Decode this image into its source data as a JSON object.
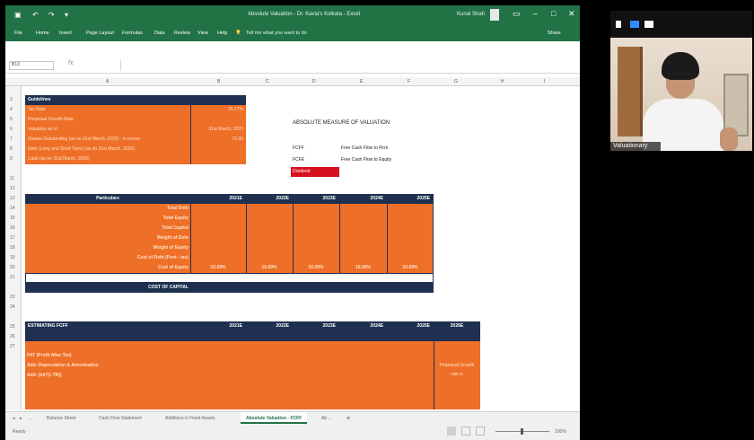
{
  "window": {
    "title": "Absolute Valuation - Dr. Kavia's Kolkata - Excel",
    "user": "Kunal Shah",
    "min_glyph": "–",
    "max_glyph": "□",
    "close_glyph": "✕"
  },
  "ribbon": {
    "tabs": [
      "File",
      "Home",
      "Insert",
      "Page Layout",
      "Formulas",
      "Data",
      "Review",
      "View",
      "Help"
    ],
    "tell_me": "Tell me what you want to do",
    "share": "Share"
  },
  "formula_bar": {
    "name_box": "B13",
    "fx": "fx"
  },
  "columns": [
    "A",
    "B",
    "C",
    "D",
    "E",
    "F",
    "G",
    "H",
    "I"
  ],
  "guidelines": {
    "header": "Guidelines",
    "rows": [
      {
        "label": "Tax Rate",
        "value": "25.17%"
      },
      {
        "label": "Perpetual Growth Rate",
        "value": ""
      },
      {
        "label": "Valuation as of",
        "value": "31st March, 2020"
      },
      {
        "label": "Shares Outstanding (as on 31st March, 2020) - in crores",
        "value": "72.00"
      },
      {
        "label": "Debt (Long and Short Term) (as on 31st March, 2020)",
        "value": ""
      },
      {
        "label": "Cash (as on 31st March, 2020)",
        "value": ""
      }
    ]
  },
  "absolute": {
    "title": "ABSOLUTE MEASURE OF VALUATION",
    "items": [
      {
        "abbr": "FCFF",
        "desc": "Free Cash Flow to Firm"
      },
      {
        "abbr": "FCFE",
        "desc": "Free Cash Flow to Equity"
      },
      {
        "abbr": "Dividend",
        "desc": ""
      }
    ]
  },
  "particulars": {
    "header": "Particulars",
    "years": [
      "2021E",
      "2022E",
      "2023E",
      "2024E",
      "2025E"
    ],
    "rows": [
      "Total Debt",
      "Total Equity",
      "Total Capital",
      "Weight of Debt",
      "Weight of Equity",
      "Cost of Debt (Post - tax)",
      "Cost of Equity"
    ],
    "cost_of_equity": [
      "10.09%",
      "10.09%",
      "10.09%",
      "10.09%",
      "10.09%"
    ],
    "cost_of_capital": "COST OF CAPITAL"
  },
  "fcff": {
    "header": "ESTIMATING FCFF",
    "years": [
      "2021E",
      "2022E",
      "2023E",
      "2024E",
      "2025E",
      "2026E"
    ],
    "rows": [
      "PAT (Profit After Tax)",
      "Add: Depreciation & Amortization",
      "Add: (Int*(1-TR))"
    ],
    "perpetual_note": "Perpetual Growth rate is"
  },
  "sheet_tabs": {
    "tabs": [
      "Balance Sheet",
      "Cash Flow Statement",
      "Additions in Fixed Assets",
      "Absolute Valuation - FCFF",
      "Ab ..."
    ],
    "active_index": 3
  },
  "status": {
    "left": "Ready",
    "zoom": "100%"
  },
  "webcam": {
    "name": "Valuationary"
  }
}
